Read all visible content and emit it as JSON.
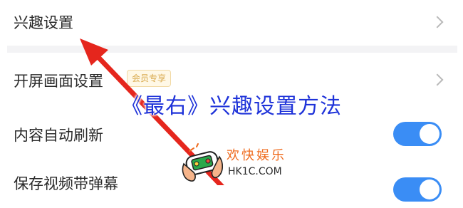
{
  "settings": {
    "items": [
      {
        "label": "兴趣设置",
        "control": "chevron"
      },
      {
        "label": "开屏画面设置",
        "badge": "会员专享",
        "control": "chevron"
      },
      {
        "label": "内容自动刷新",
        "control": "toggle",
        "enabled": true
      },
      {
        "label": "保存视频带弹幕",
        "control": "toggle",
        "enabled": true
      }
    ]
  },
  "overlay": {
    "title": "《最右》兴趣设置方法"
  },
  "watermark": {
    "name": "欢快娱乐",
    "site": "HK1C.COM"
  },
  "colors": {
    "toggle_on": "#3a8df5",
    "annotation_arrow": "#e5261d",
    "overlay_title": "#1f33d9",
    "badge_text": "#d9aa4f"
  }
}
